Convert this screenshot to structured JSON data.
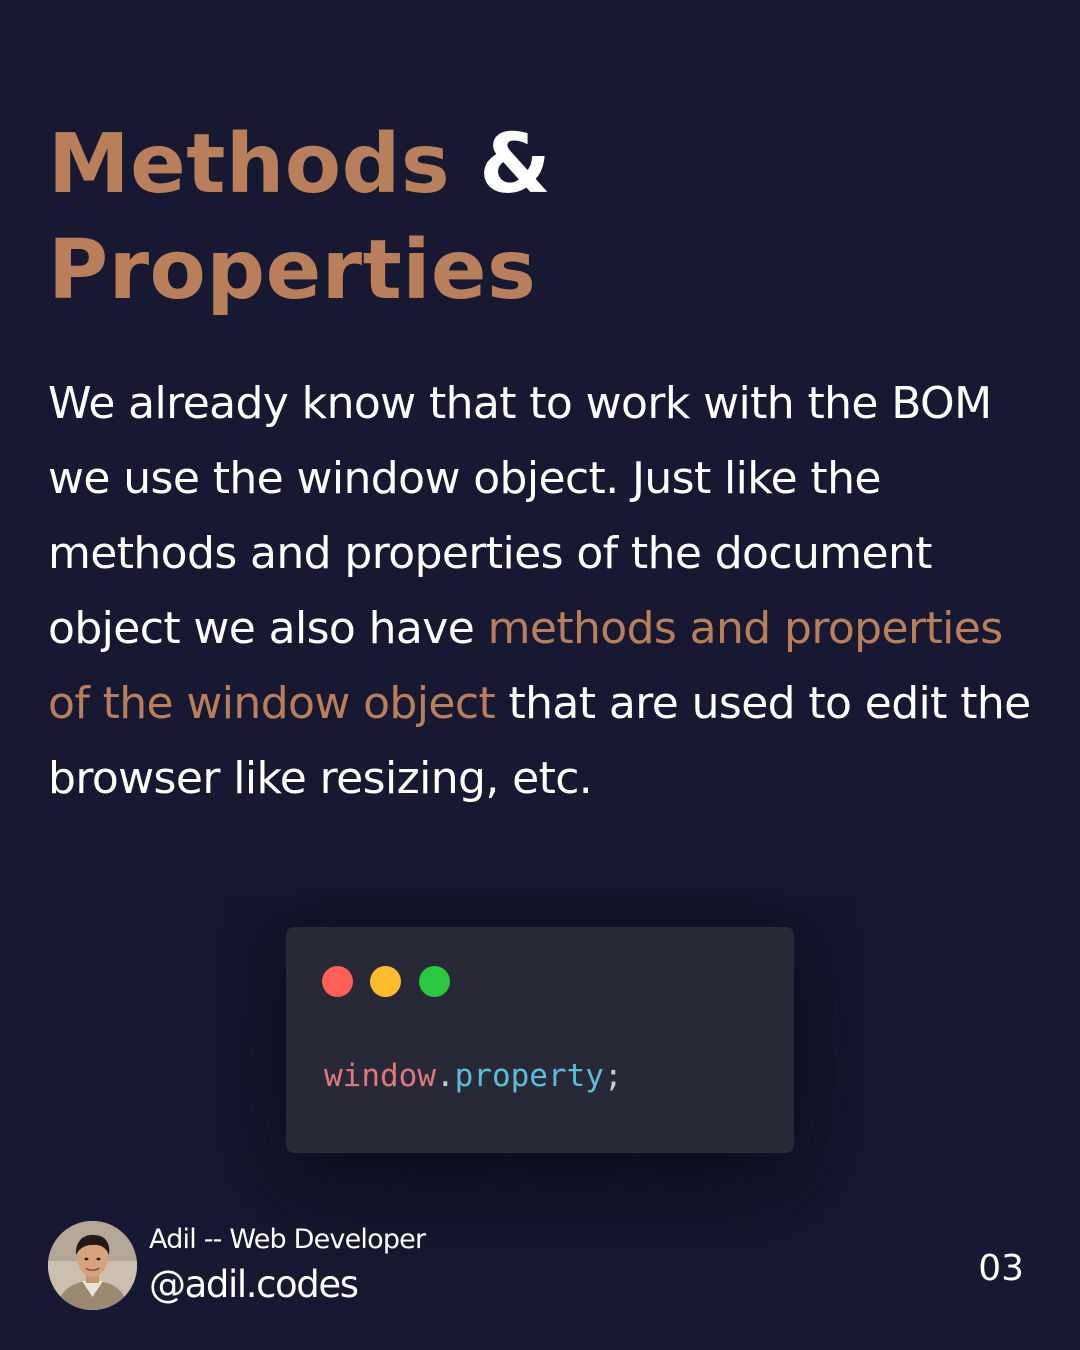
{
  "colors": {
    "background": "#171932",
    "accent": "#b97f5b",
    "text": "#ffffff",
    "code_bg": "#272a36",
    "code_object": "#e0777d",
    "code_property": "#5ebdd6"
  },
  "title": {
    "line1_accent": "Methods",
    "line1_plain": " &",
    "line2_accent": "Properties"
  },
  "body": {
    "part1": "We already know that to work with the BOM we use the window object. Just like the methods and properties of the document object we also have ",
    "highlight": "methods and properties of the window object",
    "part2": " that are used to edit the browser like resizing, etc."
  },
  "code": {
    "window_dots": [
      "red",
      "yellow",
      "green"
    ],
    "object": "window",
    "dot": ".",
    "property": "property",
    "semicolon": ";"
  },
  "author": {
    "avatar_icon": "profile-photo",
    "role": "Adil -- Web Developer",
    "handle": "@adil.codes"
  },
  "page_number": "03"
}
